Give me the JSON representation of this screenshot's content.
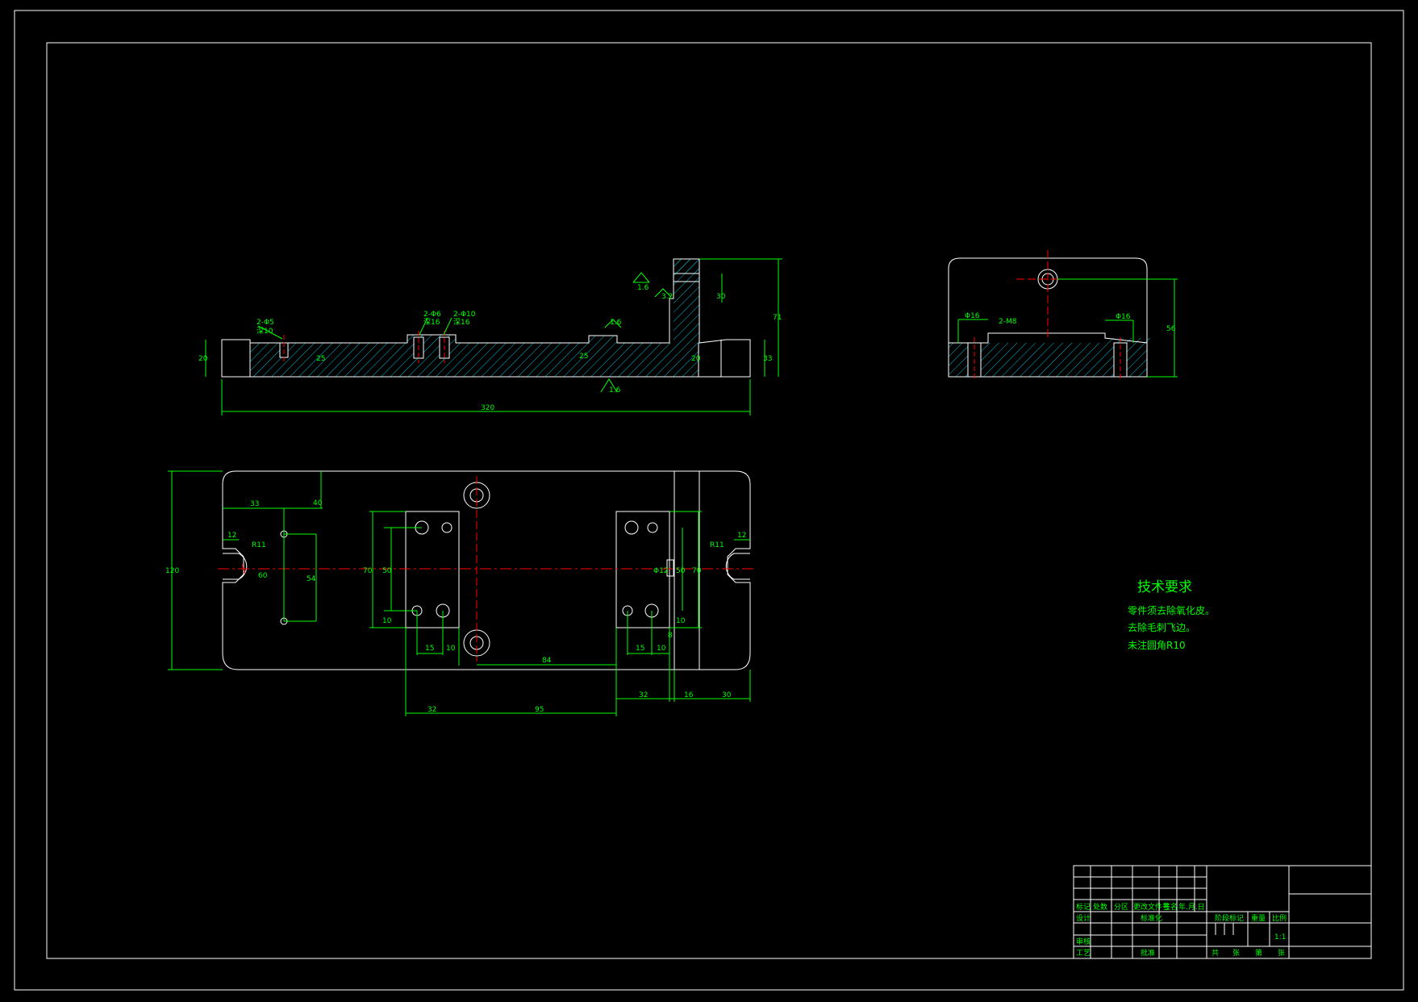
{
  "drawing": {
    "colors": {
      "background": "#000000",
      "outline": "#ffffff",
      "dimension": "#00ff00",
      "hatch": "#00bcd4",
      "centerline": "#ff0000"
    },
    "technical_requirements": {
      "title": "技术要求",
      "lines": [
        "零件须去除氧化皮。",
        "去除毛刺飞边。",
        "未注圆角R10"
      ]
    },
    "dimensions": {
      "front_view": [
        "2-Φ5",
        "深10",
        "2-Φ6",
        "深16",
        "2-Φ10",
        "深16",
        "1.6",
        "1.6",
        "1.6",
        "3.2",
        "320",
        "20",
        "25",
        "25",
        "71",
        "33",
        "20",
        "30"
      ],
      "side_view": [
        "Φ16",
        "2-M8",
        "Φ16",
        "56"
      ],
      "plan_view": [
        "12",
        "12",
        "33",
        "40",
        "R11",
        "R11",
        "60",
        "120",
        "54",
        "70",
        "50",
        "10",
        "15",
        "10",
        "84",
        "15",
        "10",
        "10",
        "50",
        "70",
        "Φ12",
        "8",
        "32",
        "95",
        "32",
        "16",
        "30"
      ]
    },
    "title_block": {
      "header": [
        "标记",
        "处数",
        "分区",
        "更改文件号",
        "签名",
        "年.月.日"
      ],
      "row_design": [
        "设计",
        "",
        "",
        "标准化"
      ],
      "row_review": [
        "审核"
      ],
      "row_process": [
        "工艺",
        "",
        "",
        "批准"
      ],
      "stage_labels": [
        "阶段标记",
        "重量",
        "比例"
      ],
      "scale": "1:1",
      "sheet_labels": [
        "共",
        "张",
        "第",
        "张"
      ]
    }
  }
}
